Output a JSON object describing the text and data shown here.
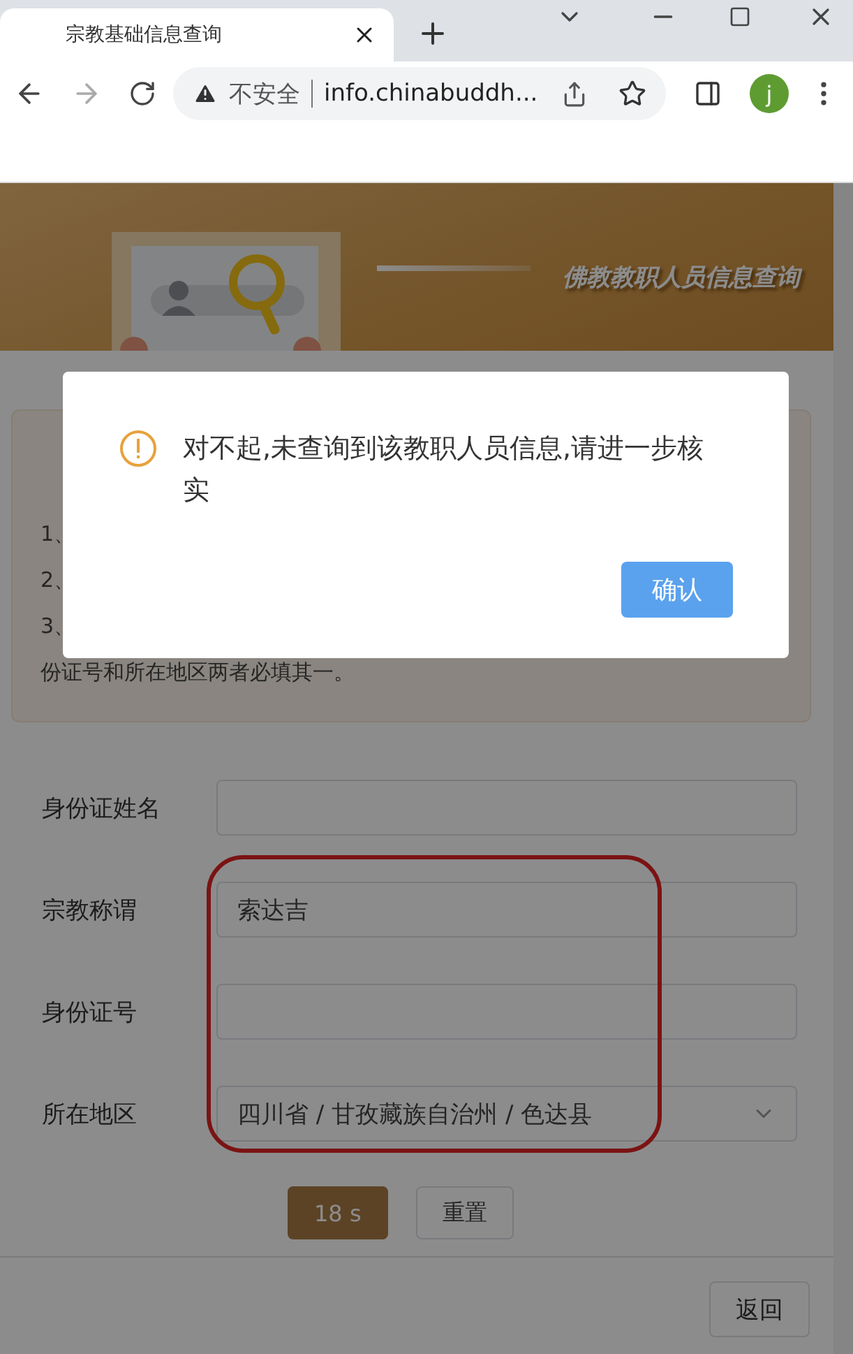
{
  "browser": {
    "tab_title": "宗教基础信息查询",
    "security_label": "不安全",
    "url": "info.chinabuddh...",
    "profile_initial": "j"
  },
  "banner": {
    "title": "佛教教职人员信息查询"
  },
  "notes": {
    "lines": [
      "1、",
      "2、",
      "3、",
      "份证号和所在地区两者必填其一。"
    ]
  },
  "form": {
    "fields": [
      {
        "label": "身份证姓名",
        "kind": "text"
      },
      {
        "label": "宗教称谓",
        "kind": "text",
        "value": "索达吉"
      },
      {
        "label": "身份证号",
        "kind": "text"
      },
      {
        "label": "所在地区",
        "kind": "select",
        "value": "四川省 / 甘孜藏族自治州 / 色达县"
      }
    ],
    "buttons": [
      {
        "label": "18 s",
        "kind": "primary",
        "disabled": true
      },
      {
        "label": "重置",
        "kind": "default",
        "disabled": false
      }
    ]
  },
  "footer": {
    "button": "返回"
  },
  "dialog": {
    "message": "对不起,未查询到该教职人员信息,请进一步核实",
    "button": "确认"
  },
  "annotation": {
    "kind": "outline"
  }
}
